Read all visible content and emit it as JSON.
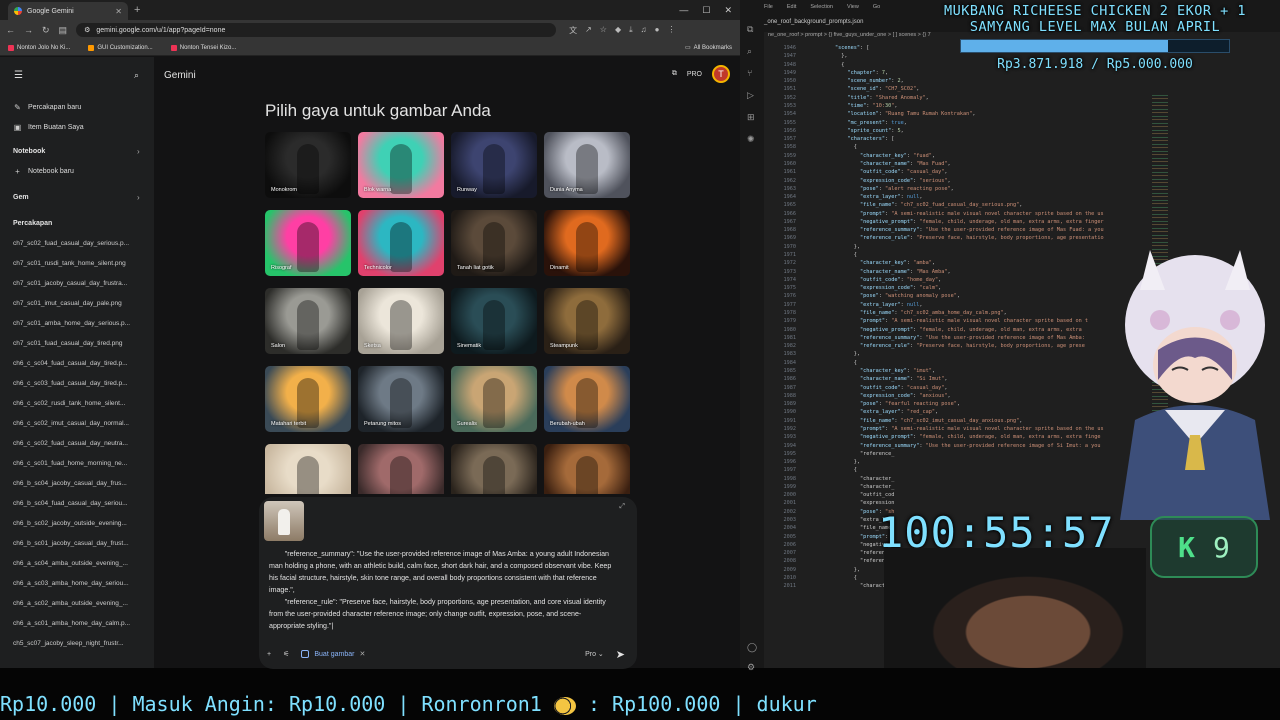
{
  "browser": {
    "tab_title": "Google Gemini",
    "url": "gemini.google.com/u/1/app?pageId=none",
    "bookmarks": [
      "Nonton Jolo No Ki...",
      "GUI Customization...",
      "Nonton Tensei Kizo..."
    ],
    "all_bookmarks": "All Bookmarks"
  },
  "sidebar": {
    "new_chat": "Percakapan baru",
    "my_stuff": "Item Buatan Saya",
    "notebook_section": "Notebook",
    "new_notebook": "Notebook baru",
    "gem_section": "Gem",
    "chats_section": "Percakapan",
    "chats": [
      "ch7_sc02_fuad_casual_day_serious.p...",
      "ch7_sc01_rusdi_tank_home_silent.png",
      "ch7_sc01_jacoby_casual_day_frustra...",
      "ch7_sc01_imut_casual_day_pale.png",
      "ch7_sc01_amba_home_day_serious.p...",
      "ch7_sc01_fuad_casual_day_tired.png",
      "ch6_c_sc04_fuad_casual_day_tired.p...",
      "ch6_c_sc03_fuad_casual_day_tired.p...",
      "ch6_c_sc02_rusdi_tank_home_silent...",
      "ch6_c_sc02_imut_casual_day_normal...",
      "ch6_c_sc02_fuad_casual_day_neutra...",
      "ch6_c_sc01_fuad_home_morning_ne...",
      "ch6_b_sc04_jacoby_casual_day_frus...",
      "ch6_b_sc04_fuad_casual_day_seriou...",
      "ch6_b_sc02_jacoby_outside_evening...",
      "ch6_b_sc01_jacoby_casual_day_frust...",
      "ch6_a_sc04_amba_outside_evening_...",
      "ch6_a_sc03_amba_home_day_seriou...",
      "ch6_a_sc02_amba_outside_evening_...",
      "ch6_a_sc01_amba_home_day_calm.p...",
      "ch5_sc07_jacoby_sleep_night_frustr..."
    ]
  },
  "main": {
    "brand": "Gemini",
    "plan_badge": "PRO",
    "avatar_letter": "T",
    "heading": "Pilih gaya untuk gambar Anda",
    "styles": [
      {
        "label": "Monokrom",
        "c1": "#2b2b2b",
        "c2": "#0d0d0d"
      },
      {
        "label": "Blok warna",
        "c1": "#3fd1b5",
        "c2": "#f27aa0"
      },
      {
        "label": "Runway",
        "c1": "#3d4470",
        "c2": "#171a2b"
      },
      {
        "label": "Dunia Anyma",
        "c1": "#b9bcc6",
        "c2": "#4f525c"
      },
      {
        "label": "Risograf",
        "c1": "#ff3fa4",
        "c2": "#26c46a"
      },
      {
        "label": "Technicolor",
        "c1": "#2cb7c2",
        "c2": "#e0416d"
      },
      {
        "label": "Tanah liat gotik",
        "c1": "#5b4a3a",
        "c2": "#1f1a16"
      },
      {
        "label": "Dinamit",
        "c1": "#e06a1f",
        "c2": "#2a120a"
      },
      {
        "label": "Salon",
        "c1": "#9a9a94",
        "c2": "#2d2d2a"
      },
      {
        "label": "Sketsa",
        "c1": "#ece6da",
        "c2": "#a8a296"
      },
      {
        "label": "Sinematik",
        "c1": "#2a4d56",
        "c2": "#0e1a1e"
      },
      {
        "label": "Steampunk",
        "c1": "#8e6c3c",
        "c2": "#2a2016"
      },
      {
        "label": "Matahari terbit",
        "c1": "#f2b04a",
        "c2": "#3a4a56"
      },
      {
        "label": "Petarung mitos",
        "c1": "#6e7a86",
        "c2": "#1e242a"
      },
      {
        "label": "Surealis",
        "c1": "#c9a574",
        "c2": "#4a6a5a"
      },
      {
        "label": "Berubah-ubah",
        "c1": "#d08a4a",
        "c2": "#2a3e5a"
      },
      {
        "label": "",
        "c1": "#e8dcc8",
        "c2": "#c9b8a0"
      },
      {
        "label": "",
        "c1": "#a06a6a",
        "c2": "#3a2a2a"
      },
      {
        "label": "",
        "c1": "#7a6a56",
        "c2": "#2a231c"
      },
      {
        "label": "",
        "c1": "#a56a3a",
        "c2": "#3a1f10"
      }
    ],
    "prompt_text": "        \"reference_summary\": \"Use the user-provided reference image of Mas Amba: a young adult Indonesian man holding a phone, with an athletic build, calm face, short dark hair, and a composed observant vibe. Keep his facial structure, hairstyle, skin tone range, and overall body proportions consistent with that reference image.\",\n        \"reference_rule\": \"Preserve face, hairstyle, body proportions, age presentation, and core visual identity from the user-provided character reference image; only change outfit, expression, pose, and scene-appropriate styling.\"|",
    "tool_chip": "Buat gambar",
    "model_label": "Pro"
  },
  "editor": {
    "menu": [
      "File",
      "Edit",
      "Selection",
      "View",
      "Go"
    ],
    "tab": "_one_roof_background_prompts.json",
    "breadcrumb": "ne_one_roof  >  prompt  >  {} five_guys_under_one  >  [ ] scenes  >  {} 7",
    "first_line": 1946,
    "code_lines": [
      "        \"scenes\": [",
      "          },",
      "          {",
      "            \"chapter\": 7,",
      "            \"scene_number\": 2,",
      "            \"scene_id\": \"CH7_SC02\",",
      "            \"title\": \"Shared Anomaly\",",
      "            \"time\": \"10:30\",",
      "            \"location\": \"Ruang Tamu Rumah Kontrakan\",",
      "            \"mc_present\": true,",
      "            \"sprite_count\": 5,",
      "            \"characters\": [",
      "              {",
      "                \"character_key\": \"fuad\",",
      "                \"character_name\": \"Mas Fuad\",",
      "                \"outfit_code\": \"casual_day\",",
      "                \"expression_code\": \"serious\",",
      "                \"pose\": \"alert reacting pose\",",
      "                \"extra_layer\": null,",
      "                \"file_name\": \"ch7_sc02_fuad_casual_day_serious.png\",",
      "                \"prompt\": \"A semi-realistic male visual novel character sprite based on the us",
      "                \"negative_prompt\": \"female, child, underage, old man, extra arms, extra finger",
      "                \"reference_summary\": \"Use the user-provided reference image of Mas Fuad: a you",
      "                \"reference_rule\": \"Preserve face, hairstyle, body proportions, age presentatio",
      "              },",
      "              {",
      "                \"character_key\": \"amba\",",
      "                \"character_name\": \"Mas Amba\",",
      "                \"outfit_code\": \"home_day\",",
      "                \"expression_code\": \"calm\",",
      "                \"pose\": \"watching anomaly pose\",",
      "                \"extra_layer\": null,",
      "                \"file_name\": \"ch7_sc02_amba_home_day_calm.png\",",
      "                \"prompt\": \"A semi-realistic male visual novel character sprite based on t",
      "                \"negative_prompt\": \"female, child, underage, old man, extra arms, extra",
      "                \"reference_summary\": \"Use the user-provided reference image of Mas Amba:",
      "                \"reference_rule\": \"Preserve face, hairstyle, body proportions, age prese",
      "              },",
      "              {",
      "                \"character_key\": \"imut\",",
      "                \"character_name\": \"Si Imut\",",
      "                \"outfit_code\": \"casual_day\",",
      "                \"expression_code\": \"anxious\",",
      "                \"pose\": \"fearful reacting pose\",",
      "                \"extra_layer\": \"red_cap\",",
      "                \"file_name\": \"ch7_sc02_imut_casual_day_anxious.png\",",
      "                \"prompt\": \"A semi-realistic male visual novel character sprite based on the us",
      "                \"negative_prompt\": \"female, child, underage, old man, extra arms, extra finge",
      "                \"reference_summary\": \"Use the user-provided reference image of Si Imut: a you",
      "                \"reference_",
      "              },",
      "              {",
      "                \"character_",
      "                \"character_",
      "                \"outfit_cod",
      "                \"expression",
      "                \"pose\": \"sh",
      "                \"extra_laye",
      "                \"file_name\"",
      "                \"prompt\":",
      "                \"negative_p",
      "                \"reference_",
      "                \"reference_",
      "              },",
      "              {",
      "                \"character_"
    ]
  },
  "overlay": {
    "donation_title": "MUKBANG RICHEESE CHICKEN 2 EKOR + 1 SAMYANG LEVEL MAX BULAN APRIL",
    "donation_amount": "Rp3.871.918 / Rp5.000.000",
    "donation_progress": 0.774,
    "timer": "100:55:57",
    "badge_letter": "K",
    "badge_number": "9",
    "ticker_text": "Rp10.000  |  Masuk Angin: Rp10.000  |  Ronronron1",
    "ticker_tail": ": Rp100.000  |  dukur"
  },
  "colors": {
    "overlay_accent": "#7fe0ff",
    "badge_green": "#4ee08a",
    "gemini_bg": "#131314"
  }
}
